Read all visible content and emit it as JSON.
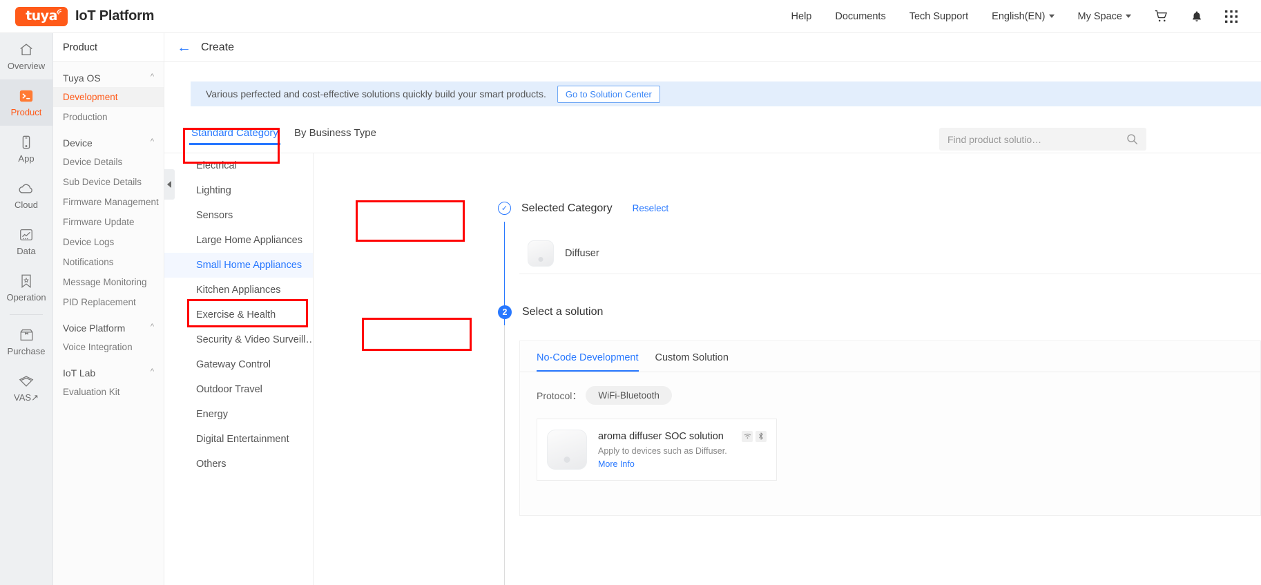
{
  "header": {
    "brand_wordmark": "tuya",
    "platform_title": "IoT Platform",
    "nav": [
      {
        "label": "Help",
        "name": "nav-help"
      },
      {
        "label": "Documents",
        "name": "nav-documents"
      },
      {
        "label": "Tech Support",
        "name": "nav-tech-support"
      },
      {
        "label": "English(EN)",
        "name": "nav-language",
        "caret": true
      },
      {
        "label": "My Space",
        "name": "nav-my-space",
        "caret": true
      }
    ],
    "icons": [
      "cart-icon",
      "bell-icon",
      "apps-grid-icon"
    ]
  },
  "rail": {
    "items": [
      {
        "label": "Overview",
        "icon": "home-icon",
        "active": false
      },
      {
        "label": "Product",
        "icon": "terminal-icon",
        "active": true
      },
      {
        "label": "App",
        "icon": "phone-icon",
        "active": false
      },
      {
        "label": "Cloud",
        "icon": "cloud-icon",
        "active": false
      },
      {
        "label": "Data",
        "icon": "chart-icon",
        "active": false
      },
      {
        "label": "Operation",
        "icon": "bookmark-star-icon",
        "active": false
      },
      {
        "label": "Purchase",
        "icon": "box-icon",
        "active": false
      },
      {
        "label": "VAS",
        "icon": "diamond-icon",
        "active": false,
        "external": "↗"
      }
    ]
  },
  "subnav": {
    "title": "Product",
    "groups": [
      {
        "title": "Tuya OS",
        "items": [
          {
            "label": "Development",
            "active": true
          },
          {
            "label": "Production",
            "active": false
          }
        ]
      },
      {
        "title": "Device",
        "items": [
          {
            "label": "Device Details",
            "active": false
          },
          {
            "label": "Sub Device Details",
            "active": false
          },
          {
            "label": "Firmware Management",
            "active": false
          },
          {
            "label": "Firmware Update",
            "active": false
          },
          {
            "label": "Device Logs",
            "active": false
          },
          {
            "label": "Notifications",
            "active": false
          },
          {
            "label": "Message Monitoring",
            "active": false
          },
          {
            "label": "PID Replacement",
            "active": false
          }
        ]
      },
      {
        "title": "Voice Platform",
        "items": [
          {
            "label": "Voice Integration",
            "active": false
          }
        ]
      },
      {
        "title": "IoT Lab",
        "items": [
          {
            "label": "Evaluation Kit",
            "active": false
          }
        ]
      }
    ]
  },
  "page": {
    "title": "Create",
    "back_icon": "back-arrow-icon"
  },
  "banner": {
    "text": "Various perfected and cost-effective solutions quickly build your smart products.",
    "button": "Go to Solution Center"
  },
  "tabs": [
    {
      "label": "Standard Category",
      "active": true
    },
    {
      "label": "By Business Type",
      "active": false
    }
  ],
  "search": {
    "placeholder": "Find product solutio…",
    "value": "",
    "icon": "search-icon"
  },
  "categories": [
    {
      "label": "Electrical",
      "active": false
    },
    {
      "label": "Lighting",
      "active": false
    },
    {
      "label": "Sensors",
      "active": false
    },
    {
      "label": "Large Home Appliances",
      "active": false
    },
    {
      "label": "Small Home Appliances",
      "active": true
    },
    {
      "label": "Kitchen Appliances",
      "active": false
    },
    {
      "label": "Exercise & Health",
      "active": false
    },
    {
      "label": "Security & Video Surveill…",
      "active": false
    },
    {
      "label": "Gateway Control",
      "active": false
    },
    {
      "label": "Outdoor Travel",
      "active": false
    },
    {
      "label": "Energy",
      "active": false
    },
    {
      "label": "Digital Entertainment",
      "active": false
    },
    {
      "label": "Others",
      "active": false
    }
  ],
  "steps": {
    "step1": {
      "label": "Selected Category",
      "reselect": "Reselect",
      "marker": "✓",
      "selected_product": "Diffuser"
    },
    "step2": {
      "number": "2",
      "label": "Select a solution"
    }
  },
  "solution_panel": {
    "tabs": [
      {
        "label": "No-Code Development",
        "active": true
      },
      {
        "label": "Custom Solution",
        "active": false
      }
    ],
    "protocol_label": "Protocol：",
    "protocol_value": "WiFi-Bluetooth",
    "items": [
      {
        "title": "aroma diffuser SOC solution",
        "desc": "Apply to devices such as Diffuser.",
        "more": "More Info",
        "badges": [
          "wifi-icon",
          "bluetooth-icon"
        ]
      }
    ]
  },
  "colors": {
    "brand_orange": "#ff5a19",
    "link_blue": "#2878ff",
    "banner_bg": "#e3eefc",
    "highlight_red": "#ff0000"
  }
}
